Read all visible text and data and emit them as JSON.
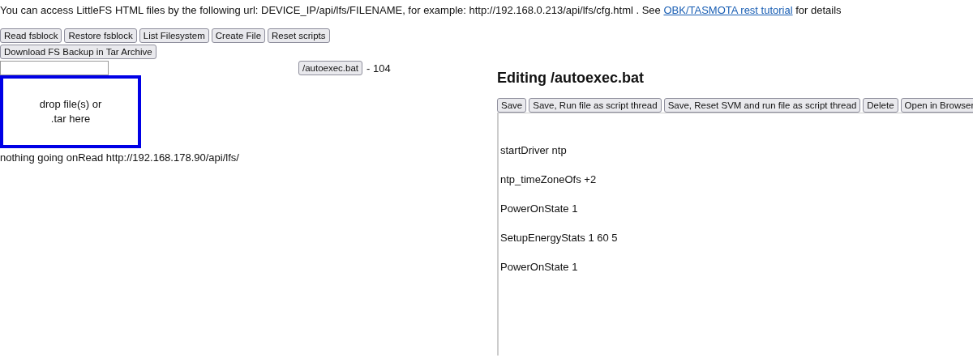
{
  "intro": {
    "text": "You can access LittleFS HTML files by the following url: DEVICE_IP/api/lfs/FILENAME, for example: http://192.168.0.213/api/lfs/cfg.html . See ",
    "link": "OBK/TASMOTA rest tutorial",
    "after": " for details"
  },
  "toolbar": [
    "Read fsblock",
    "Restore fsblock",
    "List Filesystem",
    "Create File",
    "Reset scripts"
  ],
  "toolbar2": [
    "Download FS Backup in Tar Archive"
  ],
  "files": [
    {
      "name": "/autoexec.bat",
      "size": "- 104"
    }
  ],
  "dropzone": "drop file(s) or\n.tar here",
  "status": "nothing going onRead http://192.168.178.90/api/lfs/",
  "editor": {
    "title": "Editing /autoexec.bat",
    "buttons": [
      "Save",
      "Save, Run file as script thread",
      "Save, Reset SVM and run file as script thread",
      "Delete",
      "Open in Browser"
    ],
    "lines": [
      "startDriver ntp",
      "ntp_timeZoneOfs +2",
      "PowerOnState 1",
      "SetupEnergyStats 1 60 5",
      "PowerOnState 1"
    ]
  }
}
